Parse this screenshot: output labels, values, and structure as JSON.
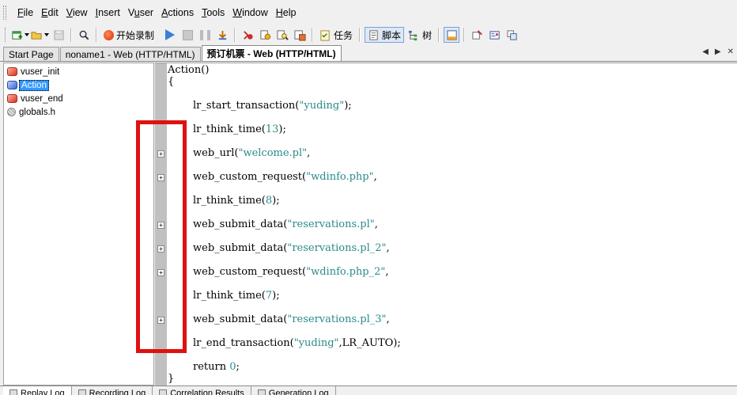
{
  "menubar": {
    "items": [
      {
        "label": "File",
        "ul": "F",
        "rest": "ile"
      },
      {
        "label": "Edit",
        "ul": "E",
        "rest": "dit"
      },
      {
        "label": "View",
        "ul": "V",
        "rest": "iew"
      },
      {
        "label": "Insert",
        "ul": "I",
        "rest": "nsert"
      },
      {
        "label": "Vuser",
        "ul": "u",
        "pre": "V",
        "rest": "ser"
      },
      {
        "label": "Actions",
        "ul": "A",
        "rest": "ctions"
      },
      {
        "label": "Tools",
        "ul": "T",
        "rest": "ools"
      },
      {
        "label": "Window",
        "ul": "W",
        "rest": "indow"
      },
      {
        "label": "Help",
        "ul": "H",
        "rest": "elp"
      }
    ]
  },
  "toolbar": {
    "record_label": "开始录制",
    "task_label": "任务",
    "script_view_label": "脚本",
    "tree_view_label": "树"
  },
  "tabs": [
    {
      "label": "Start Page",
      "active": false
    },
    {
      "label": "noname1 - Web (HTTP/HTML)",
      "active": false
    },
    {
      "label": "预订机票 - Web (HTTP/HTML)",
      "active": true
    }
  ],
  "tree": {
    "items": [
      {
        "label": "vuser_init",
        "icon": "action-red",
        "selected": false
      },
      {
        "label": "Action",
        "icon": "action-blue",
        "selected": true
      },
      {
        "label": "vuser_end",
        "icon": "action-red",
        "selected": false
      },
      {
        "label": "globals.h",
        "icon": "globals",
        "selected": false
      }
    ]
  },
  "editor": {
    "lines": [
      {
        "indent": 0,
        "fold": false,
        "parts": [
          {
            "t": "Action()",
            "c": "fn"
          }
        ]
      },
      {
        "indent": 0,
        "fold": false,
        "parts": [
          {
            "t": "{",
            "c": "fn"
          }
        ]
      },
      {
        "indent": 1,
        "fold": false,
        "parts": [
          {
            "t": "lr_start_transaction(",
            "c": "fn"
          },
          {
            "t": "\"yuding\"",
            "c": "str"
          },
          {
            "t": ");",
            "c": "fn"
          }
        ]
      },
      {
        "indent": 1,
        "fold": false,
        "parts": [
          {
            "t": "lr_think_time(",
            "c": "fn"
          },
          {
            "t": "13",
            "c": "num"
          },
          {
            "t": ");",
            "c": "fn"
          }
        ]
      },
      {
        "indent": 1,
        "fold": true,
        "parts": [
          {
            "t": "web_url(",
            "c": "fn"
          },
          {
            "t": "\"welcome.pl\"",
            "c": "str"
          },
          {
            "t": ",",
            "c": "fn"
          }
        ]
      },
      {
        "indent": 1,
        "fold": true,
        "parts": [
          {
            "t": "web_custom_request(",
            "c": "fn"
          },
          {
            "t": "\"wdinfo.php\"",
            "c": "str"
          },
          {
            "t": ",",
            "c": "fn"
          }
        ]
      },
      {
        "indent": 1,
        "fold": false,
        "parts": [
          {
            "t": "lr_think_time(",
            "c": "fn"
          },
          {
            "t": "8",
            "c": "num"
          },
          {
            "t": ");",
            "c": "fn"
          }
        ]
      },
      {
        "indent": 1,
        "fold": true,
        "parts": [
          {
            "t": "web_submit_data(",
            "c": "fn"
          },
          {
            "t": "\"reservations.pl\"",
            "c": "str"
          },
          {
            "t": ",",
            "c": "fn"
          }
        ]
      },
      {
        "indent": 1,
        "fold": true,
        "parts": [
          {
            "t": "web_submit_data(",
            "c": "fn"
          },
          {
            "t": "\"reservations.pl_2\"",
            "c": "str"
          },
          {
            "t": ",",
            "c": "fn"
          }
        ]
      },
      {
        "indent": 1,
        "fold": true,
        "parts": [
          {
            "t": "web_custom_request(",
            "c": "fn"
          },
          {
            "t": "\"wdinfo.php_2\"",
            "c": "str"
          },
          {
            "t": ",",
            "c": "fn"
          }
        ]
      },
      {
        "indent": 1,
        "fold": false,
        "parts": [
          {
            "t": "lr_think_time(",
            "c": "fn"
          },
          {
            "t": "7",
            "c": "num"
          },
          {
            "t": ");",
            "c": "fn"
          }
        ]
      },
      {
        "indent": 1,
        "fold": true,
        "parts": [
          {
            "t": "web_submit_data(",
            "c": "fn"
          },
          {
            "t": "\"reservations.pl_3\"",
            "c": "str"
          },
          {
            "t": ",",
            "c": "fn"
          }
        ]
      },
      {
        "indent": 1,
        "fold": false,
        "parts": [
          {
            "t": "lr_end_transaction(",
            "c": "fn"
          },
          {
            "t": "\"yuding\"",
            "c": "str"
          },
          {
            "t": ",LR_AUTO);",
            "c": "fn"
          }
        ]
      },
      {
        "indent": 1,
        "fold": false,
        "parts": [
          {
            "t": "return ",
            "c": "fn"
          },
          {
            "t": "0",
            "c": "num"
          },
          {
            "t": ";",
            "c": "fn"
          }
        ]
      },
      {
        "indent": 0,
        "fold": false,
        "parts": [
          {
            "t": "}",
            "c": "fn"
          }
        ]
      }
    ],
    "fold_glyph": "+"
  },
  "bottom_tabs": [
    {
      "label": "Replay Log",
      "active": true
    },
    {
      "label": "Recording Log",
      "active": false
    },
    {
      "label": "Correlation Results",
      "active": false
    },
    {
      "label": "Generation Log",
      "active": false
    }
  ],
  "colors": {
    "highlight": "#e01010",
    "selection": "#3399ff",
    "string": "#2a8a8a"
  }
}
